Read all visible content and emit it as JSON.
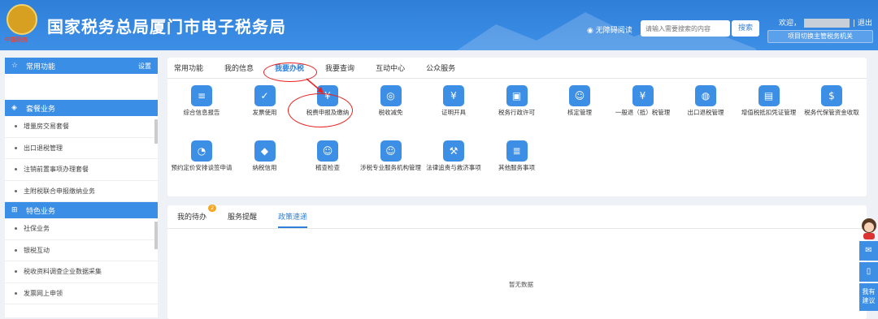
{
  "header": {
    "title": "国家税务总局厦门市电子税务局",
    "emblem_caption": "中国税务",
    "accessibility": "无障碍阅读",
    "search_placeholder": "请输入需要搜索的内容",
    "search_button": "搜索",
    "welcome": "欢迎，",
    "logout": "退出",
    "switch_authority": "项目切换主管税务机关"
  },
  "sidebar": {
    "common_title": "常用功能",
    "setting": "设置",
    "package_title": "套餐业务",
    "package_items": [
      "增量房交易套餐",
      "出口退税管理",
      "注销前置事项办理套餐",
      "主附税联合申报缴纳业务"
    ],
    "feature_title": "特色业务",
    "feature_items": [
      "社保业务",
      "银税互动",
      "税收资料调查企业数据采集",
      "发票网上申领"
    ]
  },
  "main_tabs": [
    "常用功能",
    "我的信息",
    "我要办税",
    "我要查询",
    "互动中心",
    "公众服务"
  ],
  "services": [
    {
      "label": "综合信息报告",
      "icon": "list-icon"
    },
    {
      "label": "发票使用",
      "icon": "invoice-icon"
    },
    {
      "label": "税费申报及缴纳",
      "icon": "yuan-icon"
    },
    {
      "label": "税收减免",
      "icon": "coin-icon"
    },
    {
      "label": "证明开具",
      "icon": "certificate-icon"
    },
    {
      "label": "税务行政许可",
      "icon": "id-card-icon"
    },
    {
      "label": "核定管理",
      "icon": "user-gear-icon"
    },
    {
      "label": "一般退（抵）税管理",
      "icon": "refund-icon"
    },
    {
      "label": "出口退税管理",
      "icon": "globe-icon"
    },
    {
      "label": "增值税抵扣凭证管理",
      "icon": "voucher-icon"
    },
    {
      "label": "税务代保管资金收取",
      "icon": "money-bag-icon"
    },
    {
      "label": "预约定价安排谈签申请",
      "icon": "gauge-icon"
    },
    {
      "label": "纳税信用",
      "icon": "diamond-icon"
    },
    {
      "label": "稽查检查",
      "icon": "inspector-icon"
    },
    {
      "label": "涉税专业服务机构管理",
      "icon": "agent-icon"
    },
    {
      "label": "法律追责与救济事项",
      "icon": "gavel-icon"
    },
    {
      "label": "其他服务事项",
      "icon": "document-icon"
    }
  ],
  "bottom_tabs": [
    "我的待办",
    "服务提醒",
    "政策速递"
  ],
  "todo_count": "2",
  "no_data": "暂无数据",
  "float_bar": {
    "feedback": "我有建议"
  },
  "colors": {
    "primary": "#3d8fe6",
    "annotation_red": "#e8201f"
  }
}
